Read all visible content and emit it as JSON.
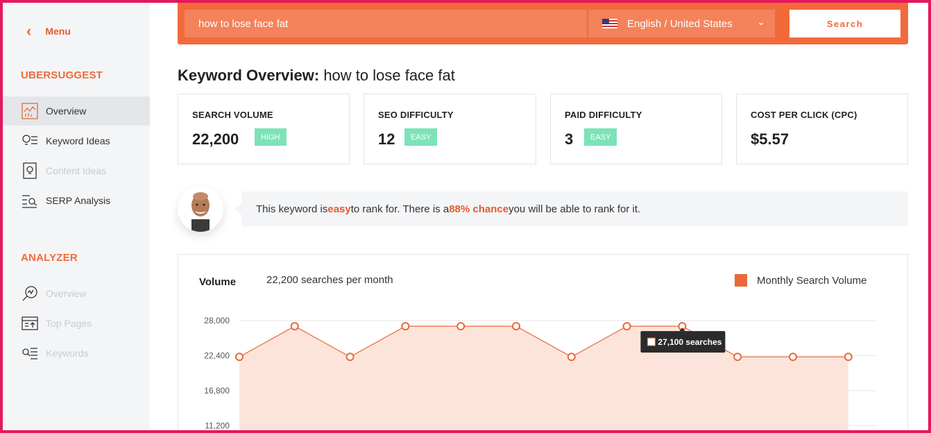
{
  "sidebar": {
    "menu_label": "Menu",
    "brand": "UBERSUGGEST",
    "items": [
      {
        "label": "Overview"
      },
      {
        "label": "Keyword Ideas"
      },
      {
        "label": "Content Ideas"
      },
      {
        "label": "SERP Analysis"
      }
    ],
    "analyzer_title": "ANALYZER",
    "analyzer_items": [
      {
        "label": "Overview"
      },
      {
        "label": "Top Pages"
      },
      {
        "label": "Keywords"
      }
    ]
  },
  "search": {
    "value": "how to lose face fat",
    "language": "English / United States",
    "button": "Search"
  },
  "overview": {
    "title_bold": "Keyword Overview:",
    "keyword": "how to lose face fat"
  },
  "cards": [
    {
      "title": "SEARCH VOLUME",
      "value": "22,200",
      "badge": "HIGH"
    },
    {
      "title": "SEO DIFFICULTY",
      "value": "12",
      "badge": "EASY"
    },
    {
      "title": "PAID DIFFICULTY",
      "value": "3",
      "badge": "EASY"
    },
    {
      "title": "COST PER CLICK (CPC)",
      "value": "$5.57"
    }
  ],
  "tip": {
    "part1": "This keyword is ",
    "easy": "easy",
    "part2": " to rank for. There is a ",
    "chance": "88% chance",
    "part3": " you will be able to rank for it."
  },
  "colors": {
    "accent": "#f26a3b",
    "badge": "#7ce3b9",
    "frame": "#e3185c"
  },
  "chart_data": {
    "type": "area",
    "title": "Volume",
    "subtitle": "22,200 searches per month",
    "legend": "Monthly Search Volume",
    "y_ticks": [
      "28,000",
      "22,400",
      "16,800",
      "11,200"
    ],
    "ylim": [
      11200,
      28000
    ],
    "series": [
      {
        "name": "Monthly Search Volume",
        "values": [
          22200,
          27100,
          22200,
          27100,
          27100,
          27100,
          22200,
          27100,
          27100,
          22200,
          22200,
          22200
        ]
      }
    ],
    "tooltip": "27,100 searches",
    "tooltip_index": 8
  }
}
